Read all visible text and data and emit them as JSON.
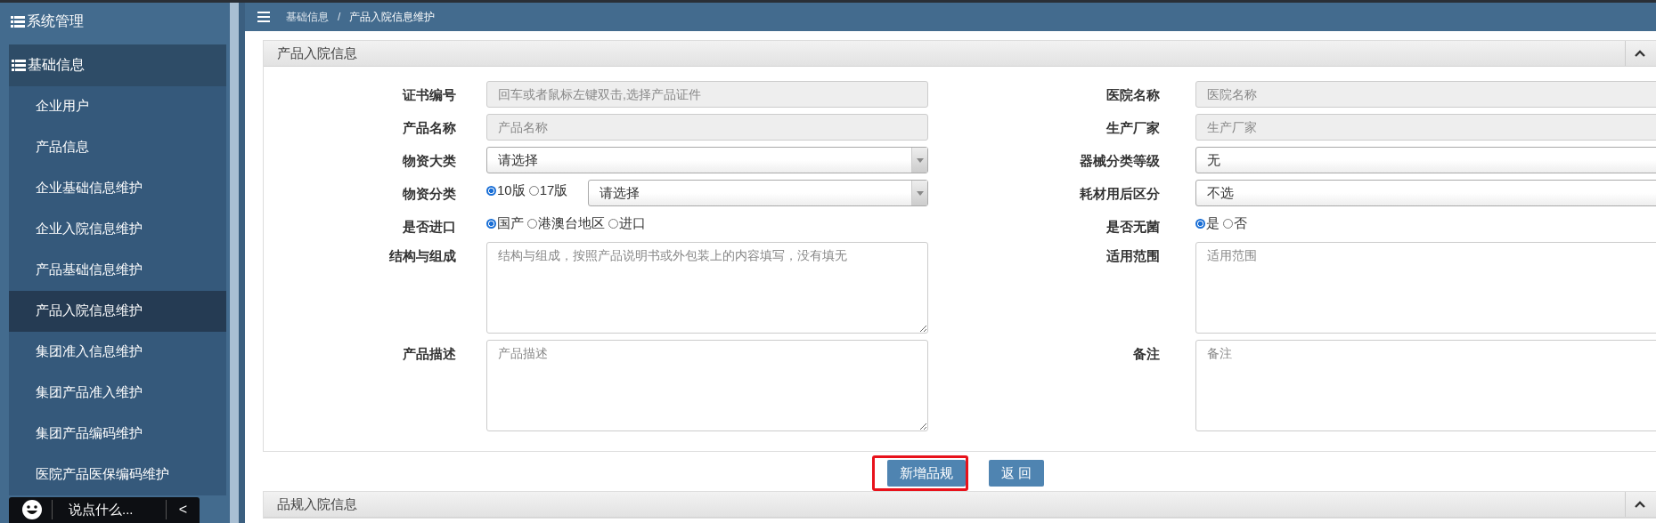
{
  "sidebar": {
    "sections": [
      {
        "label": "系统管理",
        "expanded": false
      },
      {
        "label": "基础信息",
        "expanded": true,
        "children": [
          {
            "label": "企业用户",
            "selected": false
          },
          {
            "label": "产品信息",
            "selected": false
          },
          {
            "label": "企业基础信息维护",
            "selected": false
          },
          {
            "label": "企业入院信息维护",
            "selected": false
          },
          {
            "label": "产品基础信息维护",
            "selected": false
          },
          {
            "label": "产品入院信息维护",
            "selected": true
          },
          {
            "label": "集团准入信息维护",
            "selected": false
          },
          {
            "label": "集团产品准入维护",
            "selected": false
          },
          {
            "label": "集团产品编码维护",
            "selected": false
          },
          {
            "label": "医院产品医保编码维护",
            "selected": false
          }
        ]
      }
    ],
    "chat": {
      "placeholder": "说点什么...",
      "collapse": "<"
    }
  },
  "breadcrumb": {
    "items": [
      "基础信息",
      "产品入院信息维护"
    ],
    "separator": "/"
  },
  "panel": {
    "title": "产品入院信息",
    "expanded": true,
    "rows": [
      {
        "left": {
          "kind": "readonly",
          "label": "证书编号",
          "placeholder": "回车或者鼠标左键双击,选择产品证件"
        },
        "right": {
          "kind": "readonly",
          "label": "医院名称",
          "placeholder": "医院名称"
        }
      },
      {
        "left": {
          "kind": "readonly",
          "label": "产品名称",
          "placeholder": "产品名称"
        },
        "right": {
          "kind": "readonly",
          "label": "生产厂家",
          "placeholder": "生产厂家"
        }
      },
      {
        "left": {
          "kind": "select",
          "label": "物资大类",
          "value": "请选择"
        },
        "right": {
          "kind": "select",
          "label": "器械分类等级",
          "value": "无"
        }
      },
      {
        "left": {
          "kind": "radio-select",
          "label": "物资分类",
          "options": [
            {
              "label": "10版",
              "selected": true
            },
            {
              "label": "17版",
              "selected": false
            }
          ],
          "value": "请选择"
        },
        "right": {
          "kind": "select",
          "label": "耗材用后区分",
          "value": "不选"
        }
      },
      {
        "left": {
          "kind": "radio",
          "label": "是否进口",
          "options": [
            {
              "label": "国产",
              "selected": true
            },
            {
              "label": "港澳台地区",
              "selected": false
            },
            {
              "label": "进口",
              "selected": false
            }
          ]
        },
        "right": {
          "kind": "radio",
          "label": "是否无菌",
          "options": [
            {
              "label": "是",
              "selected": true
            },
            {
              "label": "否",
              "selected": false
            }
          ]
        }
      },
      {
        "left": {
          "kind": "textarea",
          "label": "结构与组成",
          "placeholder": "结构与组成，按照产品说明书或外包装上的内容填写，没有填无"
        },
        "right": {
          "kind": "textarea",
          "label": "适用范围",
          "placeholder": "适用范围"
        }
      },
      {
        "left": {
          "kind": "textarea",
          "label": "产品描述",
          "placeholder": "产品描述"
        },
        "right": {
          "kind": "textarea",
          "label": "备注",
          "placeholder": "备注"
        }
      }
    ]
  },
  "buttons": [
    {
      "label": "新增品规",
      "highlighted": true
    },
    {
      "label": "返 回",
      "highlighted": false
    }
  ],
  "panel2": {
    "title": "品规入院信息",
    "expanded": true
  }
}
